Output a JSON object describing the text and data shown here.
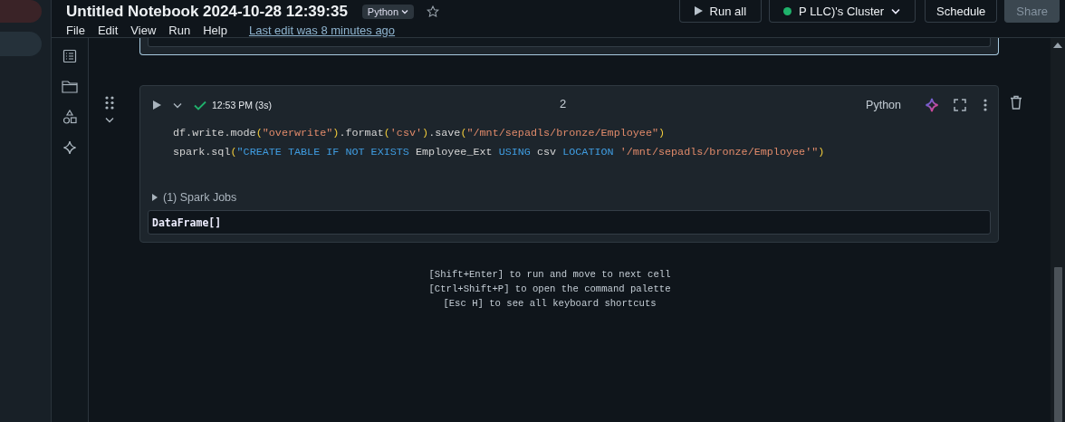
{
  "sidebar": {
    "items": [
      {
        "kind": "alert",
        "selected": false
      },
      {
        "kind": "nav",
        "selected": true
      }
    ]
  },
  "header": {
    "title": "Untitled Notebook 2024-10-28 12:39:35",
    "language": "Python",
    "starred": false,
    "menu": [
      "File",
      "Edit",
      "View",
      "Run",
      "Help"
    ],
    "last_edit": "Last edit was 8 minutes ago",
    "buttons": [
      {
        "kind": "run",
        "label": "Run all",
        "disabled": false
      },
      {
        "kind": "cluster",
        "label": "P LLC)'s Cluster",
        "running": true,
        "disabled": false
      },
      {
        "kind": "plain",
        "label": "Schedule",
        "disabled": false
      },
      {
        "kind": "primary",
        "label": "Share",
        "disabled": true
      }
    ]
  },
  "cells": [
    {
      "kind": "stub",
      "selected": true
    },
    {
      "kind": "code",
      "selected": false,
      "succeeded": true,
      "run_time": "12:53 PM (3s)",
      "number": "2",
      "language": "Python",
      "code_lines": [
        {
          "tokens": [
            {
              "kind": "plain",
              "text": "df.write.mode"
            },
            {
              "kind": "bracket",
              "text": "("
            },
            {
              "kind": "string",
              "text": "\"overwrite\""
            },
            {
              "kind": "bracket",
              "text": ")"
            },
            {
              "kind": "plain",
              "text": ".format"
            },
            {
              "kind": "bracket",
              "text": "("
            },
            {
              "kind": "string",
              "text": "'csv'"
            },
            {
              "kind": "bracket",
              "text": ")"
            },
            {
              "kind": "plain",
              "text": ".save"
            },
            {
              "kind": "bracket",
              "text": "("
            },
            {
              "kind": "string",
              "text": "\"/mnt/sepadls/bronze/Employee\""
            },
            {
              "kind": "bracket",
              "text": ")"
            }
          ]
        },
        {
          "tokens": [
            {
              "kind": "plain",
              "text": "spark.sql"
            },
            {
              "kind": "bracket",
              "text": "("
            },
            {
              "kind": "keyword",
              "text": "\"CREATE TABLE IF NOT EXISTS"
            },
            {
              "kind": "plain",
              "text": " Employee_Ext "
            },
            {
              "kind": "keyword",
              "text": "USING"
            },
            {
              "kind": "plain",
              "text": " csv "
            },
            {
              "kind": "keyword",
              "text": "LOCATION"
            },
            {
              "kind": "string",
              "text": " '/mnt/sepadls/bronze/Employee'\""
            },
            {
              "kind": "bracket",
              "text": ")"
            }
          ]
        }
      ],
      "jobs": {
        "label": "(1) Spark Jobs",
        "expanded": false
      },
      "output": "DataFrame[]"
    }
  ],
  "hints": [
    "[Shift+Enter] to run and move to next cell",
    "[Ctrl+Shift+P] to open the command palette",
    "[Esc H] to see all keyboard shortcuts"
  ]
}
